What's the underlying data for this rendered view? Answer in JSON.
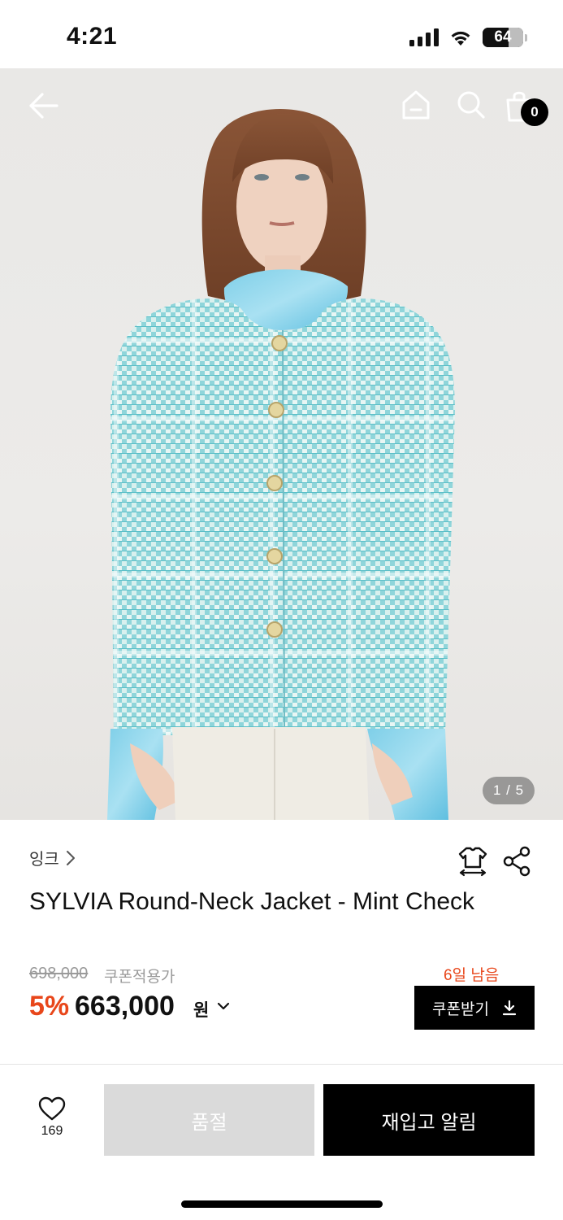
{
  "status_bar": {
    "time": "4:21",
    "battery": "64",
    "icons": [
      "signal-icon",
      "wifi-icon",
      "battery-icon"
    ]
  },
  "header": {
    "icons": [
      "back-arrow-icon",
      "home-icon",
      "search-icon",
      "cart-icon"
    ],
    "cart_count": "0"
  },
  "gallery": {
    "page_indicator": "1 / 5",
    "current": 1,
    "total": 5
  },
  "product": {
    "brand": "잉크",
    "title": "SYLVIA Round-Neck Jacket - Mint Check",
    "original_price": "698,000",
    "coupon_applied_label": "쿠폰적용가",
    "discount": "5%",
    "price": "663,000",
    "currency": "원",
    "days_left": "6일 남음",
    "coupon_button_label": "쿠폰받기"
  },
  "action_bar": {
    "like_count": "169",
    "soldout_label": "품절",
    "restock_label": "재입고 알림"
  },
  "colors": {
    "accent": "#e8461a",
    "black": "#000000",
    "disabled": "#dadada",
    "jacket": "#8fd6db"
  }
}
